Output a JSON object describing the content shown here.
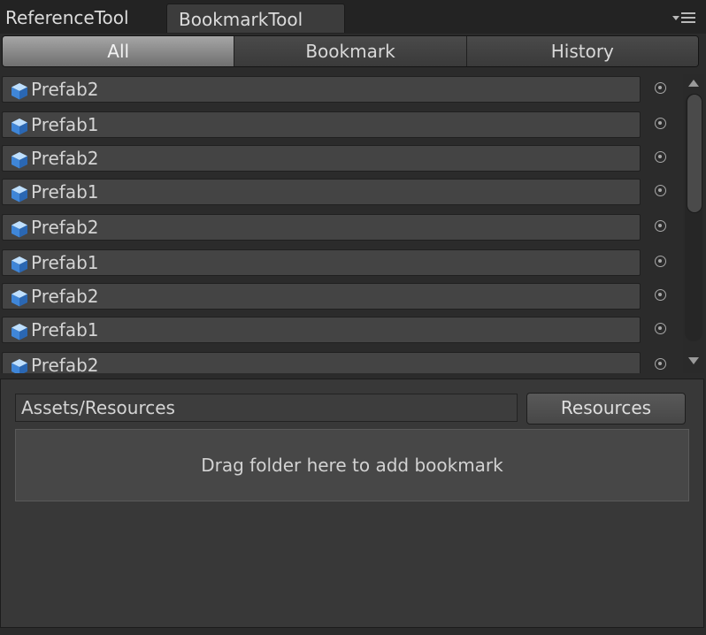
{
  "tabs": {
    "reference_tool": "ReferenceTool",
    "bookmark_tool": "BookmarkTool"
  },
  "toolbar": {
    "modes": [
      "All",
      "Bookmark",
      "History"
    ],
    "selected": "All"
  },
  "list": {
    "items": [
      {
        "label": "Prefab2"
      },
      {
        "label": "Prefab1"
      },
      {
        "label": "Prefab2"
      },
      {
        "label": "Prefab1"
      },
      {
        "label": "Prefab2"
      },
      {
        "label": "Prefab1"
      },
      {
        "label": "Prefab2"
      },
      {
        "label": "Prefab1"
      },
      {
        "label": "Prefab2"
      }
    ],
    "item_icon": "prefab-cube-icon",
    "action_icon": "object-picker-icon"
  },
  "bookmark_panel": {
    "path_value": "Assets/Resources",
    "resources_button": "Resources",
    "dropzone_text": "Drag folder here to add bookmark"
  },
  "colors": {
    "background": "#2b2b2b",
    "panel": "#383838",
    "active_segment": "#a6a6a6",
    "prefab_icon_blue": "#4a8fd8"
  }
}
